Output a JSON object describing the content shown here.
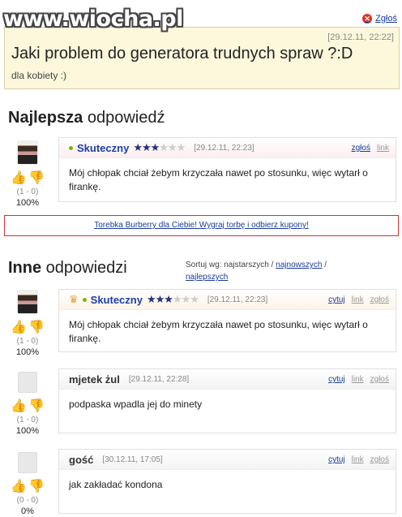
{
  "watermark": "www.wiocha.pl",
  "report_top": "Zgłoś",
  "question": {
    "date": "[29.12.11, 22:22]",
    "title": "Jaki problem do generatora trudnych spraw ?:D",
    "subtitle": "dla kobiety :)"
  },
  "best": {
    "heading_bold": "Najlepsza",
    "heading_rest": " odpowiedź",
    "votes": "(1 - 0)",
    "percent": "100%",
    "username": "Skuteczny",
    "date": "[29.12.11, 22:23]",
    "links": [
      "zgłoś",
      "link"
    ],
    "body": "Mój chłopak chciał żebym krzyczała nawet po stosunku, więc wytarł o firankę."
  },
  "ad": {
    "text": "Torebka Burberry dla Ciebie! Wygraj torbę i odbierz kupony!"
  },
  "others": {
    "heading_bold": "Inne",
    "heading_rest": " odpowiedzi",
    "sort_label": "Sortuj wg: najstarszych / ",
    "sort_newest": "najnowszych",
    "sort_sep": " /",
    "sort_best": "najlepszych",
    "answers": [
      {
        "username": "Skuteczny",
        "date": "[29.12.11, 22:23]",
        "votes": "(1 - 0)",
        "percent": "100%",
        "links": [
          "cytuj",
          "link",
          "zgłoś"
        ],
        "body": "Mój chłopak chciał żebym krzyczała nawet po stosunku, więc wytarł o firankę."
      },
      {
        "username": "mjetek żul",
        "date": "[29.12.11, 22:28]",
        "votes": "(1 - 0)",
        "percent": "100%",
        "links": [
          "cytuj",
          "link",
          "zgłoś"
        ],
        "body": "podpaska wpadla jej do minety"
      },
      {
        "username": "gość",
        "date": "[30.12.11, 17:05]",
        "votes": "(0 - 0)",
        "percent": "0%",
        "links": [
          "cytuj",
          "link",
          "zgłoś"
        ],
        "body": "jak zakładać kondona"
      }
    ]
  },
  "icons": {
    "thumb_up": "👍",
    "thumb_down": "👎",
    "crown": "♛",
    "close": "✕",
    "star_on": "★",
    "star_off": "★"
  },
  "colors": {
    "link": "#1a3c9c",
    "online": "#7ab800",
    "ad_border": "#d03030",
    "question_bg": "#fdf8dc"
  }
}
